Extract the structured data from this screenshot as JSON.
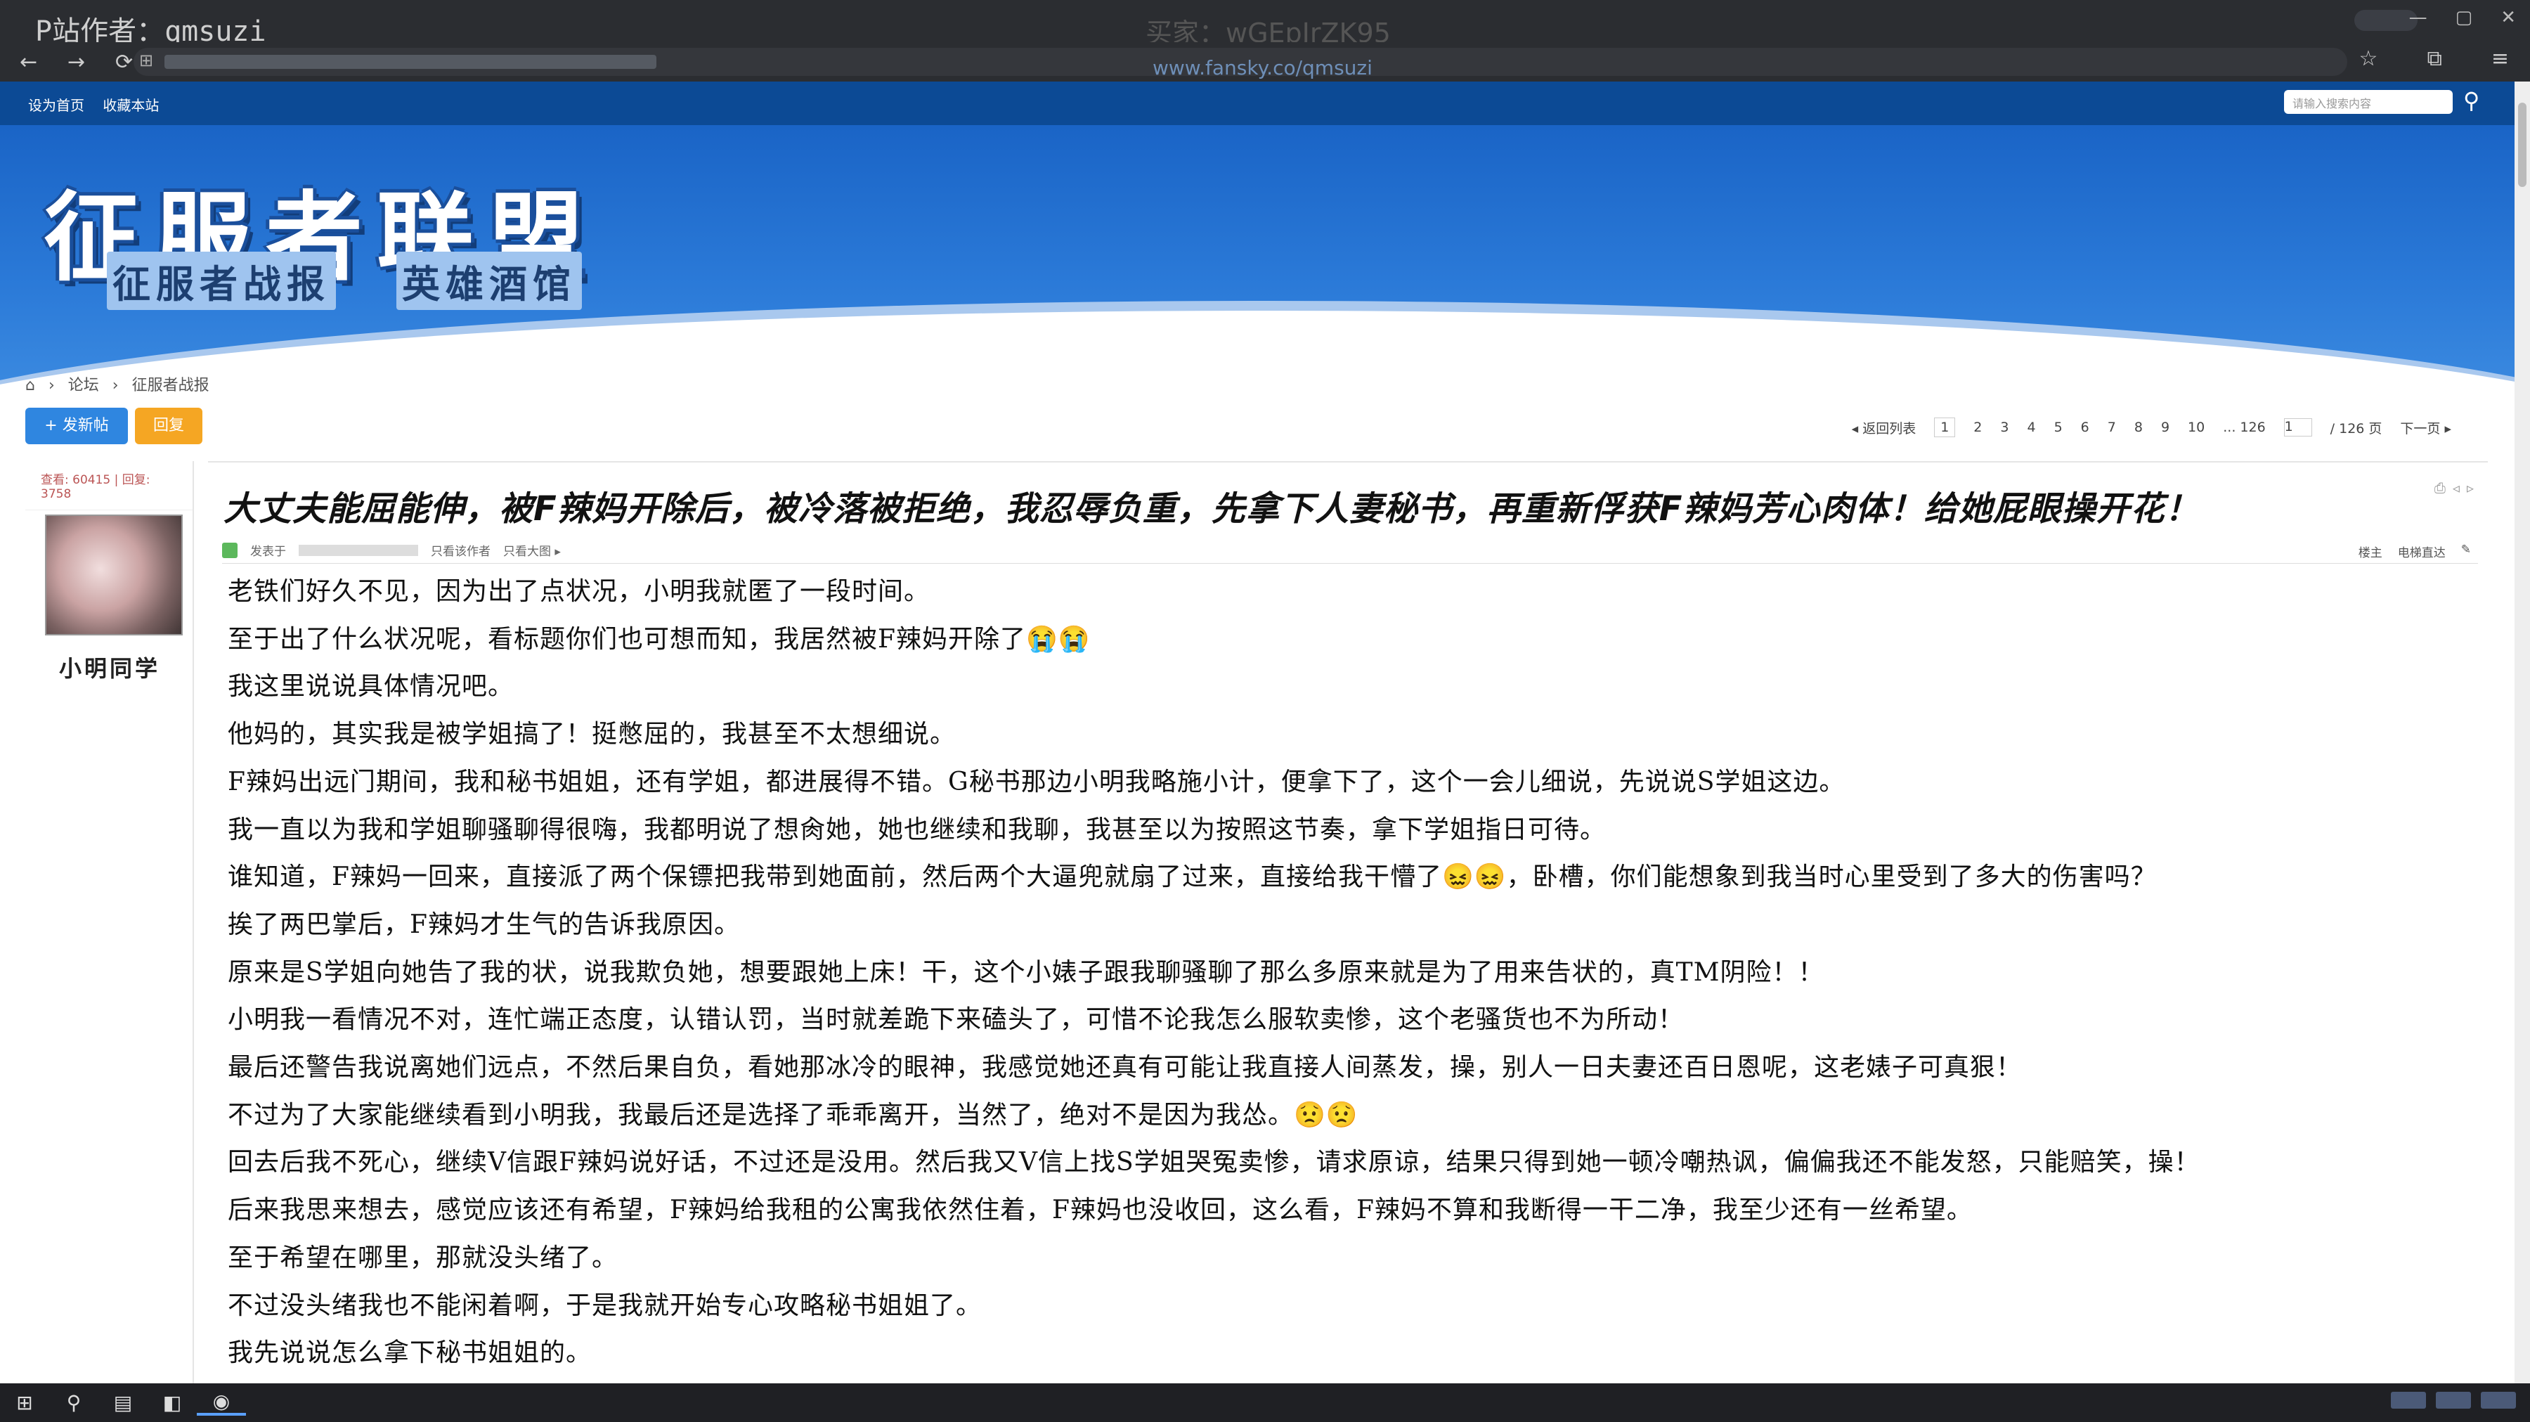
{
  "browser": {
    "watermark_author": "P站作者：qmsuzi",
    "watermark_buyer": "买家：wGEpJrZK95",
    "watermark_url": "www.fansky.co/qmsuzi",
    "nav": {
      "back": "←",
      "forward": "→",
      "reload": "⟳"
    }
  },
  "site": {
    "toplinks": [
      "设为首页",
      "收藏本站"
    ],
    "search_placeholder": "请输入搜索内容",
    "logo": "征服者联盟",
    "sublogo1": "征服者战报",
    "sublogo2": "英雄酒馆",
    "breadcrumb": [
      "论坛",
      "征服者战报"
    ]
  },
  "actions": {
    "post": "+ 发新帖",
    "reply": "回复"
  },
  "pager": {
    "back": "◂ 返回列表",
    "pages": [
      "1",
      "2",
      "3",
      "4",
      "5",
      "6",
      "7",
      "8",
      "9",
      "10"
    ],
    "last": "... 126",
    "current": "1",
    "total": "/ 126 页",
    "next": "下一页 ▸"
  },
  "author": {
    "stats": "查看: 60415 | 回复: 3758",
    "name": "小明同学"
  },
  "post": {
    "title": "大丈夫能屈能伸，被F辣妈开除后，被冷落被拒绝，我忍辱负重，先拿下人妻秘书，再重新俘获F辣妈芳心肉体！给她屁眼操开花！",
    "meta_posted": "发表于",
    "meta_only_author": "只看该作者",
    "meta_large": "只看大图 ▸",
    "meta_right": [
      "楼主",
      "电梯直达"
    ],
    "lines": [
      "老铁们好久不见，因为出了点状况，小明我就匿了一段时间。",
      "至于出了什么状况呢，看标题你们也可想而知，我居然被F辣妈开除了😭😭",
      "我这里说说具体情况吧。",
      "他妈的，其实我是被学姐搞了！挺憋屈的，我甚至不太想细说。",
      "F辣妈出远门期间，我和秘书姐姐，还有学姐，都进展得不错。G秘书那边小明我略施小计，便拿下了，这个一会儿细说，先说说S学姐这边。",
      "我一直以为我和学姐聊骚聊得很嗨，我都明说了想肏她，她也继续和我聊，我甚至以为按照这节奏，拿下学姐指日可待。",
      "谁知道，F辣妈一回来，直接派了两个保镖把我带到她面前，然后两个大逼兜就扇了过来，直接给我干懵了😖😖，卧槽，你们能想象到我当时心里受到了多大的伤害吗？",
      "挨了两巴掌后，F辣妈才生气的告诉我原因。",
      "原来是S学姐向她告了我的状，说我欺负她，想要跟她上床！干，这个小婊子跟我聊骚聊了那么多原来就是为了用来告状的，真TM阴险！！",
      "小明我一看情况不对，连忙端正态度，认错认罚，当时就差跪下来磕头了，可惜不论我怎么服软卖惨，这个老骚货也不为所动！",
      "最后还警告我说离她们远点，不然后果自负，看她那冰冷的眼神，我感觉她还真有可能让我直接人间蒸发，操，别人一日夫妻还百日恩呢，这老婊子可真狠！",
      "不过为了大家能继续看到小明我，我最后还是选择了乖乖离开，当然了，绝对不是因为我怂。😟😟",
      "回去后我不死心，继续V信跟F辣妈说好话，不过还是没用。然后我又V信上找S学姐哭冤卖惨，请求原谅，结果只得到她一顿冷嘲热讽，偏偏我还不能发怒，只能赔笑，操！",
      "后来我思来想去，感觉应该还有希望，F辣妈给我租的公寓我依然住着，F辣妈也没收回，这么看，F辣妈不算和我断得一干二净，我至少还有一丝希望。",
      "至于希望在哪里，那就没头绪了。",
      "不过没头绪我也不能闲着啊，于是我就开始专心攻略秘书姐姐了。",
      "我先说说怎么拿下秘书姐姐的。"
    ]
  },
  "icons": {
    "search": "search-icon",
    "home": "home-icon"
  },
  "colors": {
    "banner": "#1a64c6",
    "strip": "#0c4a95",
    "post_btn": "#2f86e0",
    "reply_btn": "#f5a623"
  }
}
